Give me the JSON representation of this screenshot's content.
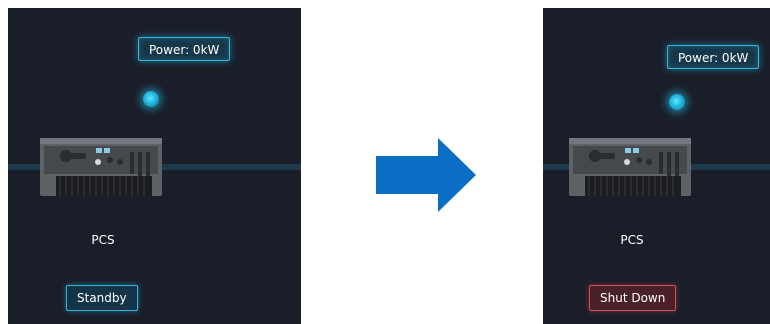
{
  "left_panel": {
    "power_label": "Power: 0kW",
    "device_label": "PCS",
    "status_label": "Standby",
    "status_color": "#36b3d6"
  },
  "right_panel": {
    "power_label": "Power: 0kW",
    "device_label": "PCS",
    "status_label": "Shut Down",
    "status_color": "#d0505a"
  },
  "arrow": {
    "icon": "right-arrow-icon",
    "color": "#0a6fc4"
  },
  "colors": {
    "panel_bg": "#1a1e29",
    "accent": "#33b6d9",
    "line": "#1c3a4c"
  }
}
